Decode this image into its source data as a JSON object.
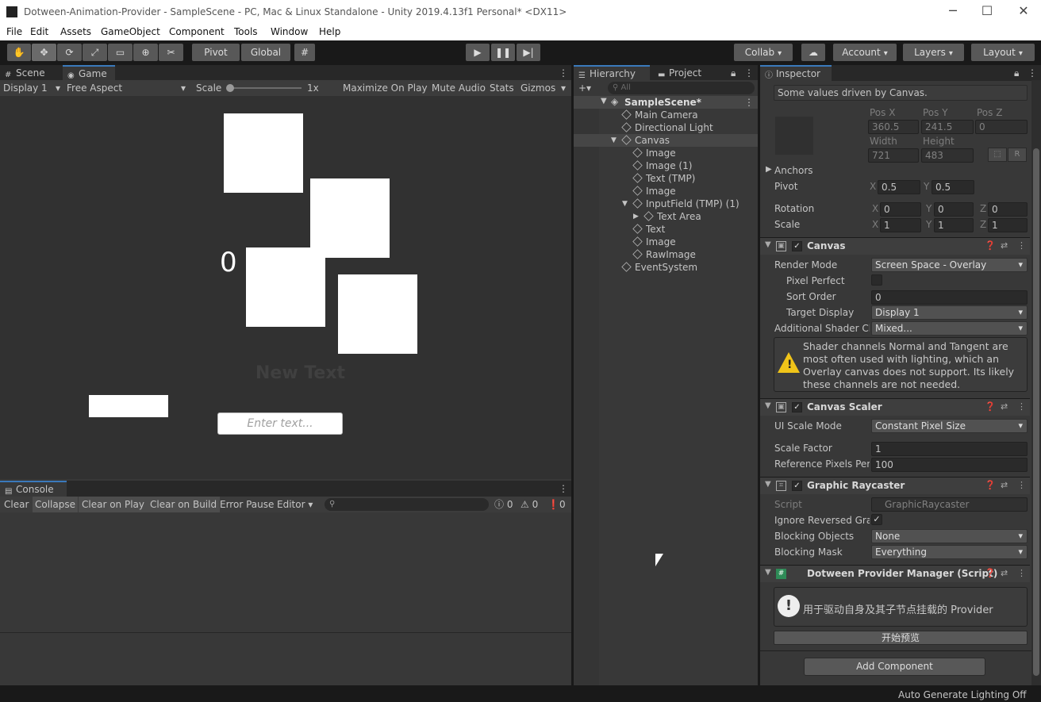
{
  "window": {
    "title": "Dotween-Animation-Provider - SampleScene - PC, Mac & Linux Standalone - Unity 2019.4.13f1 Personal* <DX11>",
    "minimize": "─",
    "maximize": "☐",
    "close": "✕"
  },
  "menu": [
    "File",
    "Edit",
    "Assets",
    "GameObject",
    "Component",
    "Tools",
    "Window",
    "Help"
  ],
  "toolbar": {
    "pivot": "Pivot",
    "global": "Global",
    "collab": "Collab",
    "account": "Account",
    "layers": "Layers",
    "layout": "Layout"
  },
  "game_panel": {
    "tabs": [
      "Scene",
      "Game"
    ],
    "display": "Display 1",
    "aspect": "Free Aspect",
    "scale_label": "Scale",
    "scale_value": "1x",
    "maximize_on_play": "Maximize On Play",
    "mute_audio": "Mute Audio",
    "stats": "Stats",
    "gizmos": "Gizmos",
    "counter_text": "0",
    "new_text": "New Text",
    "input_placeholder": "Enter text..."
  },
  "console": {
    "tab": "Console",
    "buttons": [
      "Clear",
      "Collapse",
      "Clear on Play",
      "Clear on Build",
      "Error Pause",
      "Editor"
    ],
    "log_count": "0",
    "warn_count": "0",
    "error_count": "0"
  },
  "hierarchy": {
    "tabs": [
      "Hierarchy",
      "Project"
    ],
    "search_placeholder": "All",
    "scene": "SampleScene*",
    "items": [
      {
        "label": "Main Camera",
        "depth": 1
      },
      {
        "label": "Directional Light",
        "depth": 1
      },
      {
        "label": "Canvas",
        "depth": 1,
        "expanded": true,
        "selected": true
      },
      {
        "label": "Image",
        "depth": 2
      },
      {
        "label": "Image (1)",
        "depth": 2
      },
      {
        "label": "Text (TMP)",
        "depth": 2
      },
      {
        "label": "Image",
        "depth": 2
      },
      {
        "label": "InputField (TMP) (1)",
        "depth": 2,
        "expanded": true
      },
      {
        "label": "Text Area",
        "depth": 3,
        "collapsed": true
      },
      {
        "label": "Text",
        "depth": 2
      },
      {
        "label": "Image",
        "depth": 2
      },
      {
        "label": "RawImage",
        "depth": 2
      },
      {
        "label": "EventSystem",
        "depth": 1
      }
    ]
  },
  "inspector": {
    "tab": "Inspector",
    "driven_note": "Some values driven by Canvas.",
    "rect": {
      "pos_x_label": "Pos X",
      "pos_y_label": "Pos Y",
      "pos_z_label": "Pos Z",
      "pos_x": "360.5",
      "pos_y": "241.5",
      "pos_z": "0",
      "width_label": "Width",
      "height_label": "Height",
      "width": "721",
      "height": "483",
      "r_button": "R"
    },
    "anchors_label": "Anchors",
    "pivot_label": "Pivot",
    "pivot_x": "0.5",
    "pivot_y": "0.5",
    "rotation_label": "Rotation",
    "rot_x": "0",
    "rot_y": "0",
    "rot_z": "0",
    "scale_label": "Scale",
    "scale_x": "1",
    "scale_y": "1",
    "scale_z": "1",
    "axis": {
      "x": "X",
      "y": "Y",
      "z": "Z"
    },
    "canvas": {
      "title": "Canvas",
      "render_mode_label": "Render Mode",
      "render_mode": "Screen Space - Overlay",
      "pixel_perfect_label": "Pixel Perfect",
      "sort_order_label": "Sort Order",
      "sort_order": "0",
      "target_display_label": "Target Display",
      "target_display": "Display 1",
      "shader_channels_label": "Additional Shader Chi",
      "shader_channels": "Mixed...",
      "warning": "Shader channels Normal and Tangent are most often used with lighting, which an Overlay canvas does not support. Its likely these channels are not needed."
    },
    "canvas_scaler": {
      "title": "Canvas Scaler",
      "ui_scale_mode_label": "UI Scale Mode",
      "ui_scale_mode": "Constant Pixel Size",
      "scale_factor_label": "Scale Factor",
      "scale_factor": "1",
      "ref_pixels_label": "Reference Pixels Per",
      "ref_pixels": "100"
    },
    "raycaster": {
      "title": "Graphic Raycaster",
      "script_label": "Script",
      "script": "GraphicRaycaster",
      "ignore_reversed_label": "Ignore Reversed Grap",
      "blocking_objects_label": "Blocking Objects",
      "blocking_objects": "None",
      "blocking_mask_label": "Blocking Mask",
      "blocking_mask": "Everything"
    },
    "dotween": {
      "title": "Dotween Provider Manager (Script)",
      "info": "用于驱动自身及其子节点挂载的 Provider",
      "preview_button": "开始预览"
    },
    "add_component": "Add Component"
  },
  "status_bar": {
    "text": "Auto Generate Lighting Off"
  },
  "colors": {
    "accent": "#3a79bb",
    "panel": "#383838",
    "game_bg": "#313131",
    "warning": "#f0c419"
  }
}
